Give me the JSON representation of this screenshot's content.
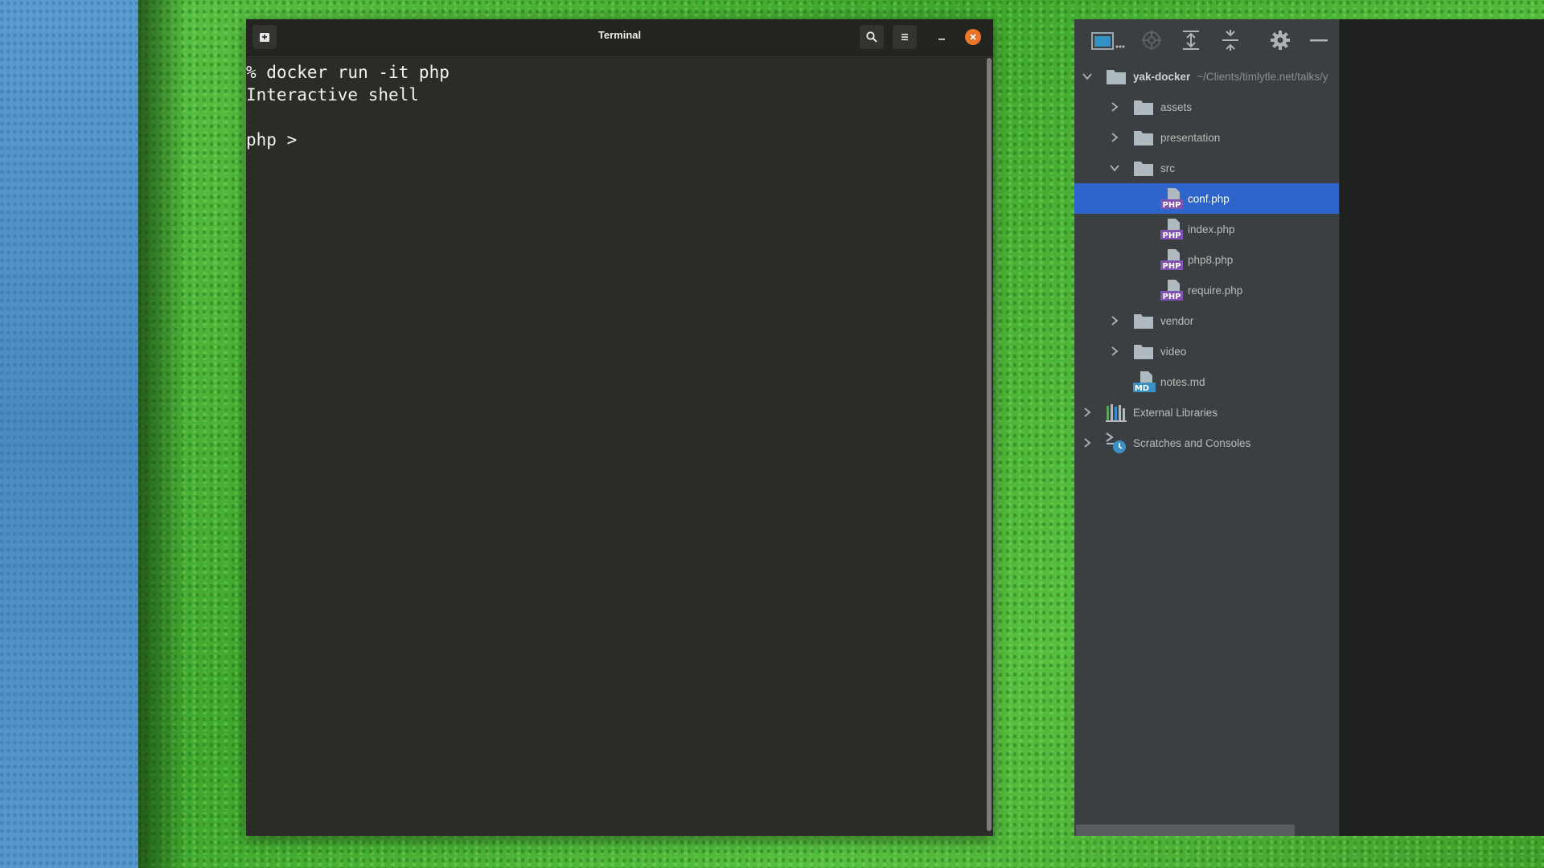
{
  "terminal": {
    "title": "Terminal",
    "lines": [
      "% docker run -it php",
      "Interactive shell",
      "",
      "php > "
    ],
    "buttons": {
      "new_tab_icon": "new-tab-icon",
      "search_icon": "search-icon",
      "menu_icon": "hamburger-menu-icon",
      "minimize_icon": "minimize-icon",
      "close_icon": "close-icon"
    }
  },
  "project": {
    "toolbar": [
      "project-view-icon",
      "locate-icon",
      "expand-all-icon",
      "collapse-all-icon",
      "gear-icon",
      "hide-icon"
    ],
    "root": {
      "name": "yak-docker",
      "path": "~/Clients/timlytle.net/talks/y"
    },
    "items": [
      {
        "label": "assets",
        "type": "folder",
        "level": 1,
        "expanded": false
      },
      {
        "label": "presentation",
        "type": "folder",
        "level": 1,
        "expanded": false
      },
      {
        "label": "src",
        "type": "folder",
        "level": 1,
        "expanded": true
      },
      {
        "label": "conf.php",
        "type": "php",
        "level": 2,
        "selected": true
      },
      {
        "label": "index.php",
        "type": "php",
        "level": 2
      },
      {
        "label": "php8.php",
        "type": "php",
        "level": 2
      },
      {
        "label": "require.php",
        "type": "php",
        "level": 2
      },
      {
        "label": "vendor",
        "type": "folder",
        "level": 1,
        "expanded": false
      },
      {
        "label": "video",
        "type": "folder",
        "level": 1,
        "expanded": false
      },
      {
        "label": "notes.md",
        "type": "md",
        "level": 1
      },
      {
        "label": "External Libraries",
        "type": "libraries",
        "level": 0,
        "expanded": false
      },
      {
        "label": "Scratches and Consoles",
        "type": "scratches",
        "level": 0,
        "expanded": false
      }
    ],
    "file_badges": {
      "php": "PHP",
      "md": "MD"
    }
  },
  "colors": {
    "selection": "#2f65ca",
    "terminal_bg": "#2b2c28",
    "panel_bg": "#3c3f41",
    "close_orange": "#e9752a"
  }
}
